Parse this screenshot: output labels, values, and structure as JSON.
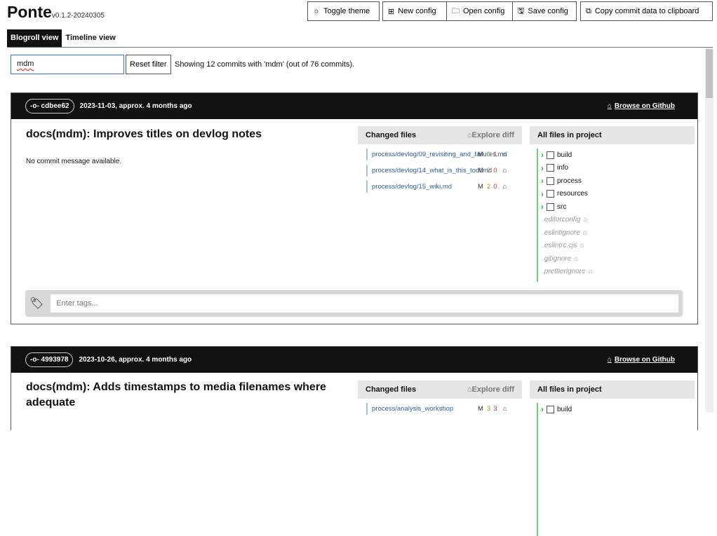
{
  "app": {
    "name": "Ponte",
    "version": "v0.1.2-20240305"
  },
  "toolbar": {
    "toggle_theme": "Toggle theme",
    "new_config": "New config",
    "open_config": "Open config",
    "save_config": "Save config",
    "copy": "Copy commit data to clipboard"
  },
  "tabs": [
    {
      "label": "Blogroll view"
    },
    {
      "label": "Timeline view"
    }
  ],
  "filter": {
    "value": "mdm",
    "reset": "Reset filter",
    "status": "Showing 12 commits with 'mdm' (out of 76 commits)."
  },
  "labels": {
    "browse": "Browse on Github",
    "changed": "Changed files",
    "explore": "Explore diff",
    "all_files": "All files in project",
    "tags_placeholder": "Enter tags..."
  },
  "commits": [
    {
      "hash": "cdbee62",
      "date": "2023-11-03, approx. 4 months ago",
      "title": "docs(mdm): Improves titles on devlog notes",
      "message": "No commit message available.",
      "files": [
        {
          "path": "process/devlog/09_revisiting_and_failures.md",
          "status": "M",
          "add": "0",
          "del": "1"
        },
        {
          "path": "process/devlog/14_what_is_this_tool.md",
          "status": "M",
          "add": "2",
          "del": "0"
        },
        {
          "path": "process/devlog/15_wiki.md",
          "status": "M",
          "add": "2",
          "del": "0"
        }
      ],
      "dirs": [
        "build",
        "info",
        "process",
        "resources",
        "src"
      ],
      "project_files": [
        ".editorconfig",
        ".eslintignore",
        ".eslintrc.cjs",
        ".gitignore",
        ".prettierignore"
      ]
    },
    {
      "hash": "4993978",
      "date": "2023-10-26, approx. 4 months ago",
      "title": "docs(mdm): Adds timestamps to media filenames where adequate",
      "files": [
        {
          "path": "process/analysis_workshop",
          "status": "M",
          "add": "3",
          "del": "3"
        }
      ],
      "dirs": [
        "build"
      ]
    }
  ]
}
